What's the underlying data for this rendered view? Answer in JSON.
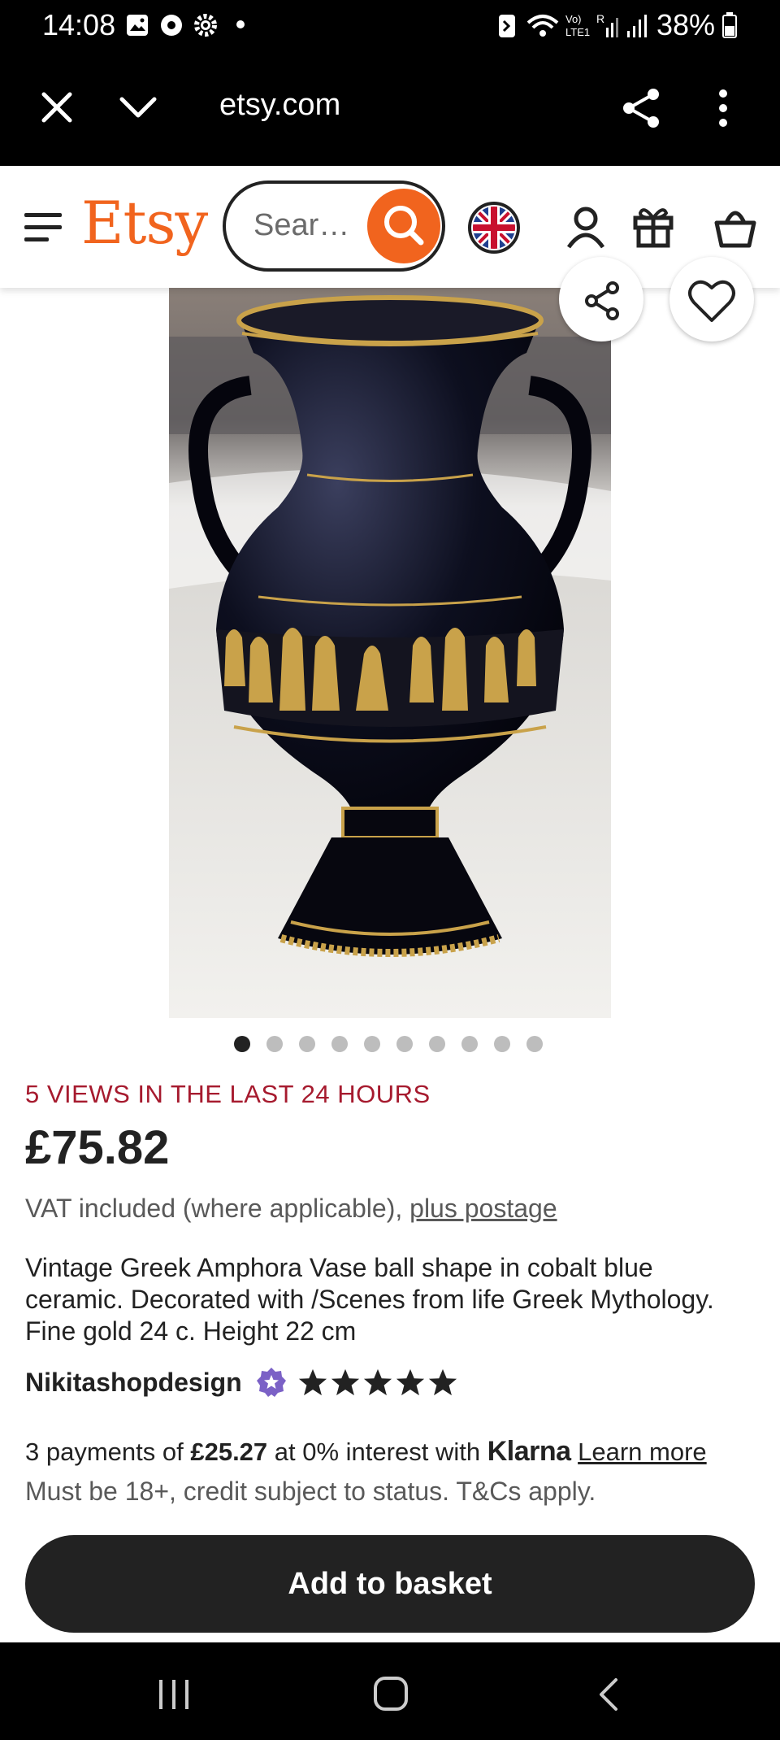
{
  "status_bar": {
    "time": "14:08",
    "battery": "38%"
  },
  "browser": {
    "url": "etsy.com"
  },
  "header": {
    "logo": "Etsy",
    "search_placeholder": "Sear…"
  },
  "product": {
    "image_count": 10,
    "active_image_index": 0,
    "views": "5 VIEWS IN THE LAST 24 HOURS",
    "price": "£75.82",
    "vat_text": "VAT included (where applicable), ",
    "postage_link": "plus postage",
    "title": "Vintage Greek Amphora Vase ball shape in cobalt blue ceramic. Decorated with /Scenes from life Greek Mythology. Fine gold 24 c. Height 22 cm",
    "shop_name": "Nikitashopdesign",
    "rating_stars": 5
  },
  "klarna": {
    "prefix": "3 payments of ",
    "amount": "£25.27",
    "middle": " at 0% interest with ",
    "brand": "Klarna",
    "learn_more": "Learn more",
    "disclaimer": "Must be 18+, credit subject to status. T&Cs apply."
  },
  "actions": {
    "add_to_basket": "Add to basket"
  },
  "colors": {
    "brand": "#F1641E",
    "views": "#A61A2E",
    "button": "#222222"
  }
}
